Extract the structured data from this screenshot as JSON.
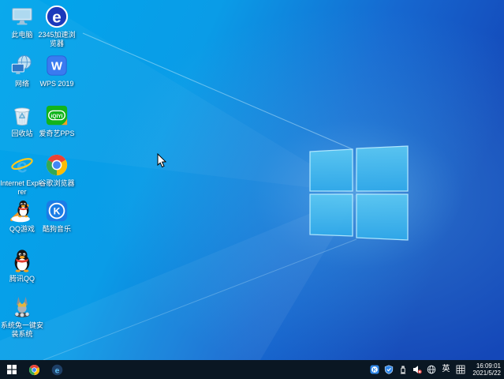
{
  "colors": {
    "wallpaper_left": "#00a6ec",
    "wallpaper_right": "#1447b8",
    "logo_pane_light": "#5cc9f2",
    "logo_pane_dark": "#2fa9e9",
    "taskbar_bg": "#0a1723",
    "label_text": "#ffffff",
    "muted_badge": "#e04343"
  },
  "desktop": {
    "icons": [
      {
        "name": "this-pc",
        "label": "此电脑"
      },
      {
        "name": "2345-browser",
        "label": "2345加速浏览器",
        "glyph": "e"
      },
      {
        "name": "network",
        "label": "网络"
      },
      {
        "name": "wps-2019",
        "label": "WPS 2019",
        "glyph": "W"
      },
      {
        "name": "recycle-bin",
        "label": "回收站"
      },
      {
        "name": "iqiyi-pps",
        "label": "爱奇艺PPS",
        "glyph": "iQIYI"
      },
      {
        "name": "internet-explorer",
        "label": "Internet Explorer",
        "glyph": "e"
      },
      {
        "name": "chrome",
        "label": "谷歌浏览器"
      },
      {
        "name": "qq-games",
        "label": "QQ游戏"
      },
      {
        "name": "kugou-music",
        "label": "酷狗音乐",
        "glyph": "K"
      },
      {
        "name": "tencent-qq",
        "label": "腾讯QQ"
      },
      {
        "name": "system-rabbit",
        "label": "系统兔一键安装系统"
      }
    ]
  },
  "taskbar": {
    "left_icons": [
      {
        "name": "start"
      },
      {
        "name": "chrome"
      },
      {
        "name": "2345-browser",
        "glyph": "e"
      }
    ],
    "tray_icons": [
      {
        "name": "kugou-music",
        "glyph": "K"
      },
      {
        "name": "security-shield"
      },
      {
        "name": "usb-device"
      },
      {
        "name": "volume-muted"
      },
      {
        "name": "network-globe"
      },
      {
        "name": "ime-language",
        "label": "英"
      },
      {
        "name": "ime-grid"
      }
    ],
    "clock": {
      "time": "16:09:01",
      "date": "2021/5/22"
    }
  }
}
